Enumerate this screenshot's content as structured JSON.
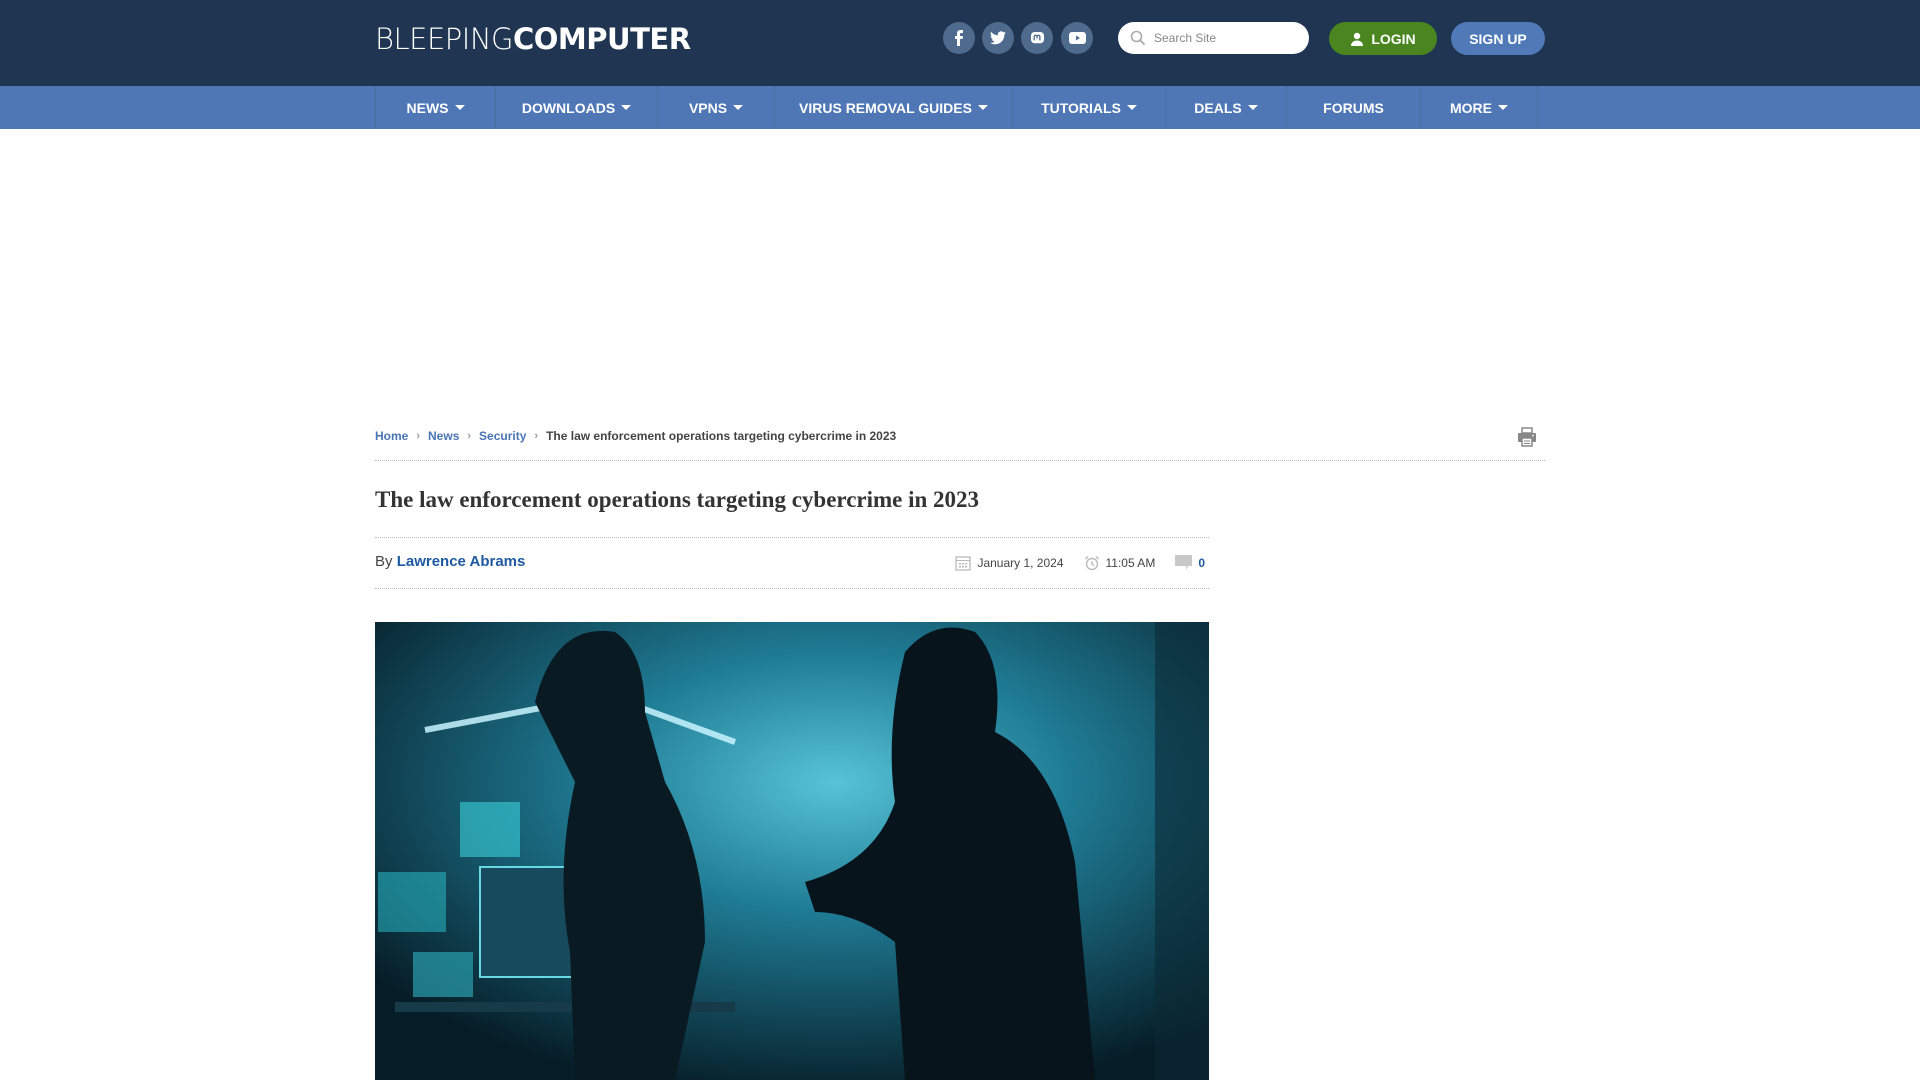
{
  "header": {
    "logo_light": "BLEEPING",
    "logo_bold": "COMPUTER",
    "social": [
      {
        "name": "facebook-icon",
        "glyph": "f"
      },
      {
        "name": "twitter-icon",
        "glyph": "🐦"
      },
      {
        "name": "mastodon-icon",
        "glyph": "m"
      },
      {
        "name": "youtube-icon",
        "glyph": "▶"
      }
    ],
    "search_placeholder": "Search Site",
    "login_label": "LOGIN",
    "signup_label": "SIGN UP"
  },
  "nav": {
    "items": [
      {
        "label": "NEWS",
        "dropdown": true
      },
      {
        "label": "DOWNLOADS",
        "dropdown": true
      },
      {
        "label": "VPNS",
        "dropdown": true
      },
      {
        "label": "VIRUS REMOVAL GUIDES",
        "dropdown": true
      },
      {
        "label": "TUTORIALS",
        "dropdown": true
      },
      {
        "label": "DEALS",
        "dropdown": true
      },
      {
        "label": "FORUMS",
        "dropdown": false
      },
      {
        "label": "MORE",
        "dropdown": true
      }
    ]
  },
  "breadcrumb": {
    "home": "Home",
    "news": "News",
    "security": "Security",
    "current": "The law enforcement operations targeting cybercrime in 2023"
  },
  "article": {
    "title": "The law enforcement operations targeting cybercrime in 2023",
    "by_label": "By",
    "author": "Lawrence Abrams",
    "date": "January 1, 2024",
    "time": "11:05 AM",
    "comments": "0"
  },
  "colors": {
    "header_bg": "#1f3552",
    "nav_bg": "#5077b5",
    "login_green": "#4a8520",
    "signup_blue": "#5079b8",
    "link_blue": "#1f5aa0"
  }
}
